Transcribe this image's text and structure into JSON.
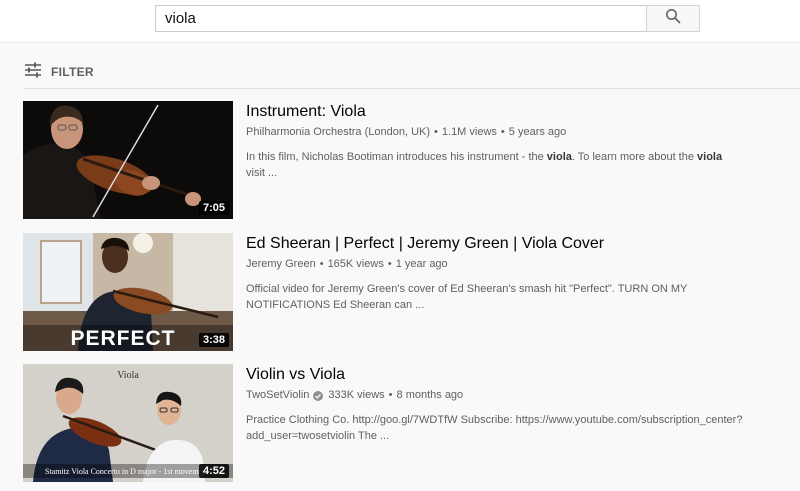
{
  "search": {
    "query": "viola"
  },
  "filter": {
    "label": "FILTER"
  },
  "results": [
    {
      "title": "Instrument: Viola",
      "channel": "Philharmonia Orchestra (London, UK)",
      "views": "1.1M views",
      "age": "5 years ago",
      "duration": "7:05",
      "desc_parts": [
        "In this film, Nicholas Bootiman introduces his instrument - the ",
        "viola",
        ". To learn more about the ",
        "viola",
        " visit ..."
      ]
    },
    {
      "title": "Ed Sheeran | Perfect | Jeremy Green | Viola Cover",
      "channel": "Jeremy Green",
      "views": "165K views",
      "age": "1 year ago",
      "duration": "3:38",
      "thumb_text": "PERFECT",
      "desc_line1": "Official video for Jeremy Green's cover of Ed Sheeran's smash hit \"Perfect\". TURN ON MY",
      "desc_line2": "NOTIFICATIONS Ed Sheeran can ..."
    },
    {
      "title": "Violin vs Viola",
      "channel": "TwoSetViolin",
      "views": "333K views",
      "age": "8 months ago",
      "duration": "4:52",
      "thumb_top_text": "Viola",
      "thumb_caption": "Stamitz Viola Concerto in D major - 1st movement",
      "desc_line1": "Practice Clothing Co. http://goo.gl/7WDTfW Subscribe: https://www.youtube.com/subscription_center?",
      "desc_line2": "add_user=twosetviolin The ..."
    }
  ]
}
